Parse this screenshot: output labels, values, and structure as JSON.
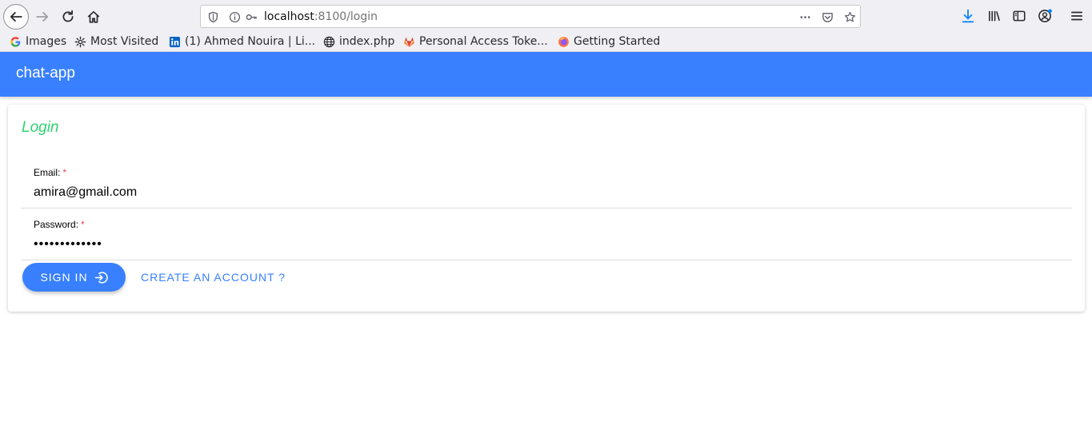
{
  "browser": {
    "url_host": "localhost",
    "url_rest": ":8100/login",
    "bookmarks": [
      {
        "label": "Images",
        "icon": "google-icon"
      },
      {
        "label": "Most Visited",
        "icon": "gear-icon"
      },
      {
        "label": "(1) Ahmed Nouira | Li...",
        "icon": "linkedin-icon"
      },
      {
        "label": "index.php",
        "icon": "globe-icon"
      },
      {
        "label": "Personal Access Toke...",
        "icon": "gitlab-icon"
      },
      {
        "label": "Getting Started",
        "icon": "firefox-icon"
      }
    ]
  },
  "app": {
    "title": "chat-app",
    "colors": {
      "primary": "#3880ff",
      "success": "#2dd36f",
      "danger": "#eb445a"
    }
  },
  "login": {
    "title": "Login",
    "email_label": "Email:",
    "email_value": "amira@gmail.com",
    "password_label": "Password:",
    "password_value": "•••••••••••••",
    "required_mark": "*",
    "signin_label": "SIGN IN",
    "create_account_label": "CREATE AN ACCOUNT ?"
  }
}
